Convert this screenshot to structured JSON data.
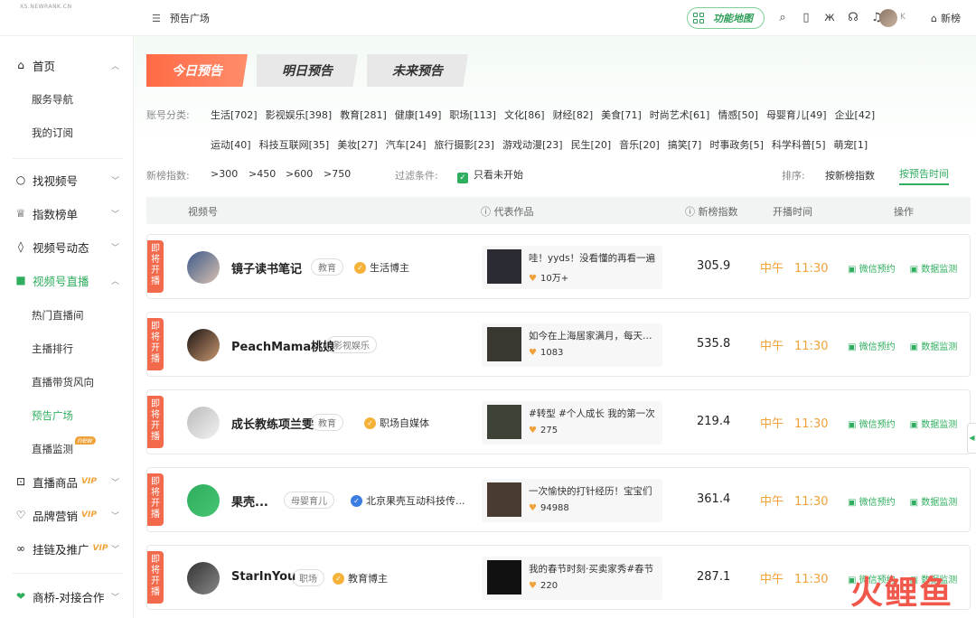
{
  "header": {
    "logo_main": "新视",
    "logo_sub": "XS.NEWRANK.CN",
    "breadcrumb": "预告广场",
    "function_map": "功能地图",
    "home": "新榜",
    "user_suffix": "K"
  },
  "sidebar": {
    "home": "首页",
    "service_nav": "服务导航",
    "my_subs": "我的订阅",
    "find_channel": "找视频号",
    "rank": "指数榜单",
    "dynamics": "视频号动态",
    "live": "视频号直播",
    "live_sub": [
      "热门直播间",
      "主播排行",
      "直播带货风向",
      "预告广场",
      "直播监测"
    ],
    "new_tag": "new",
    "products": "直播商品",
    "brand": "品牌营销",
    "promo": "挂链及推广",
    "vip": "VIP",
    "business": "商桥-对接合作"
  },
  "tabs": [
    "今日预告",
    "明日预告",
    "未来预告"
  ],
  "filters": {
    "category_label": "账号分类:",
    "categories_row1": [
      "生活[702]",
      "影视娱乐[398]",
      "教育[281]",
      "健康[149]",
      "职场[113]",
      "文化[86]",
      "财经[82]",
      "美食[71]",
      "时尚艺术[61]",
      "情感[50]",
      "母婴育儿[49]",
      "企业[42]"
    ],
    "categories_row2": [
      "运动[40]",
      "科技互联网[35]",
      "美妆[27]",
      "汽车[24]",
      "旅行摄影[23]",
      "游戏动漫[23]",
      "民生[20]",
      "音乐[20]",
      "搞笑[7]",
      "时事政务[5]",
      "科学科普[5]",
      "萌宠[1]"
    ],
    "index_label": "新榜指数:",
    "index_options": [
      ">300",
      ">450",
      ">600",
      ">750"
    ],
    "filter_label": "过滤条件:",
    "filter_option": "只看未开始",
    "sort_label": "排序:",
    "sort_index": "按新榜指数",
    "sort_time": "按预告时间"
  },
  "table": {
    "headers": [
      "视频号",
      "代表作品",
      "新榜指数",
      "开播时间",
      "操作"
    ],
    "ribbon": "即将开播",
    "ops": [
      "微信预约",
      "数据监测"
    ],
    "rows": [
      {
        "name": "镜子读书笔记",
        "tag": "教育",
        "cert": "生活博主",
        "work": "哇！yyds！没看懂的再看一遍",
        "likes": "10万+",
        "score": "305.9",
        "period": "中午",
        "time": "11:30"
      },
      {
        "name": "PeachMama桃娘",
        "tag": "影视娱乐",
        "cert": "",
        "work": "如今在上海居家满月，每天都在",
        "likes": "1083",
        "score": "535.8",
        "period": "中午",
        "time": "11:30"
      },
      {
        "name": "成长教练项兰雯",
        "tag": "教育",
        "cert": "职场自媒体",
        "work": "#转型 #个人成长 我的第一次",
        "likes": "275",
        "score": "219.4",
        "period": "中午",
        "time": "11:30"
      },
      {
        "name": "果壳...",
        "tag": "母婴育儿",
        "cert": "北京果壳互动科技传...",
        "work": "一次愉快的打针经历！宝宝们",
        "likes": "94988",
        "score": "361.4",
        "period": "中午",
        "time": "11:30"
      },
      {
        "name": "StarInYou",
        "tag": "职场",
        "cert": "教育博主",
        "work": "我的春节时刻·买卖家秀#春节",
        "likes": "220",
        "score": "287.1",
        "period": "中午",
        "time": "11:30"
      }
    ]
  },
  "watermark": "新视",
  "corner_logo": "火鲤鱼",
  "avatar_badge": "果壳 童字馆"
}
